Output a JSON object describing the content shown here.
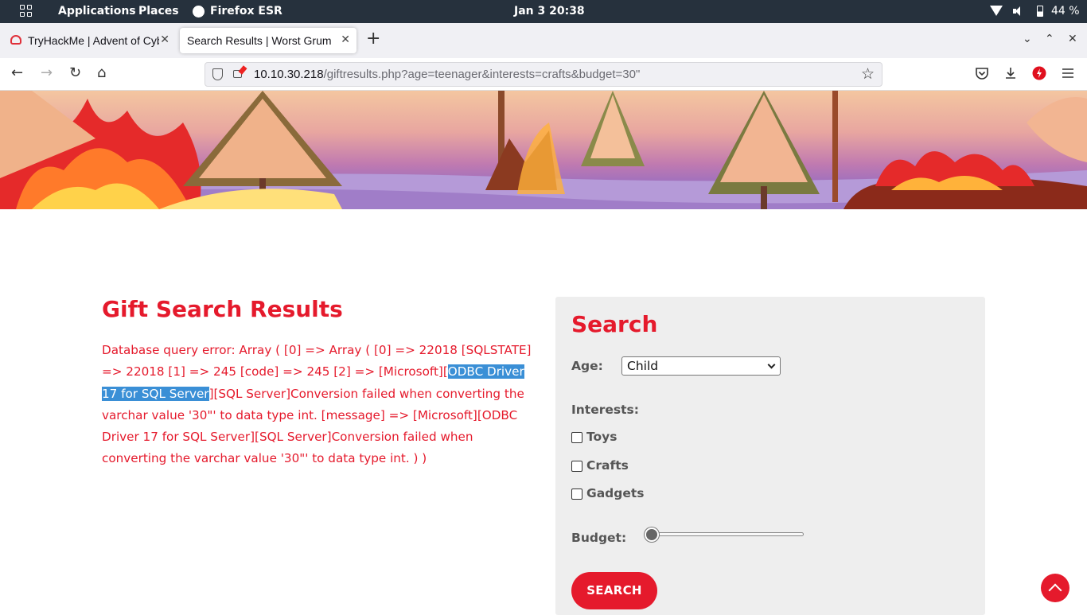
{
  "system_bar": {
    "applications": "Applications",
    "places": "Places",
    "browser_name": "Firefox ESR",
    "clock": "Jan 3  20:38",
    "battery": "44 %"
  },
  "tabs": [
    {
      "title": "TryHackMe | Advent of Cyber",
      "active": false
    },
    {
      "title": "Search Results | Worst Grumpy",
      "active": true
    }
  ],
  "address_bar": {
    "host": "10.10.30.218",
    "path": "/giftresults.php?age=teenager&interests=crafts&budget=30\""
  },
  "page": {
    "results_heading": "Gift Search Results",
    "error": {
      "before": "Database query error: Array ( [0] => Array ( [0] => 22018 [SQLSTATE] => 22018 [1] => 245 [code] => 245 [2] => [Microsoft][",
      "selected": "ODBC Driver 17 for SQL Server",
      "after": "][SQL Server]Conversion failed when converting the varchar value '30\"' to data type int. [message] => [Microsoft][ODBC Driver 17 for SQL Server][SQL Server]Conversion failed when converting the varchar value '30\"' to data type int. ) )"
    },
    "search_panel": {
      "heading": "Search",
      "age_label": "Age:",
      "age_value": "Child",
      "interests_label": "Interests:",
      "interests": [
        "Toys",
        "Crafts",
        "Gadgets"
      ],
      "budget_label": "Budget:",
      "budget_value": 0,
      "button": "SEARCH"
    }
  },
  "colors": {
    "accent": "#e51a2c",
    "selection": "#3a8fd6",
    "panel_bg": "#eeeeee",
    "topbar_bg": "#26313d"
  }
}
